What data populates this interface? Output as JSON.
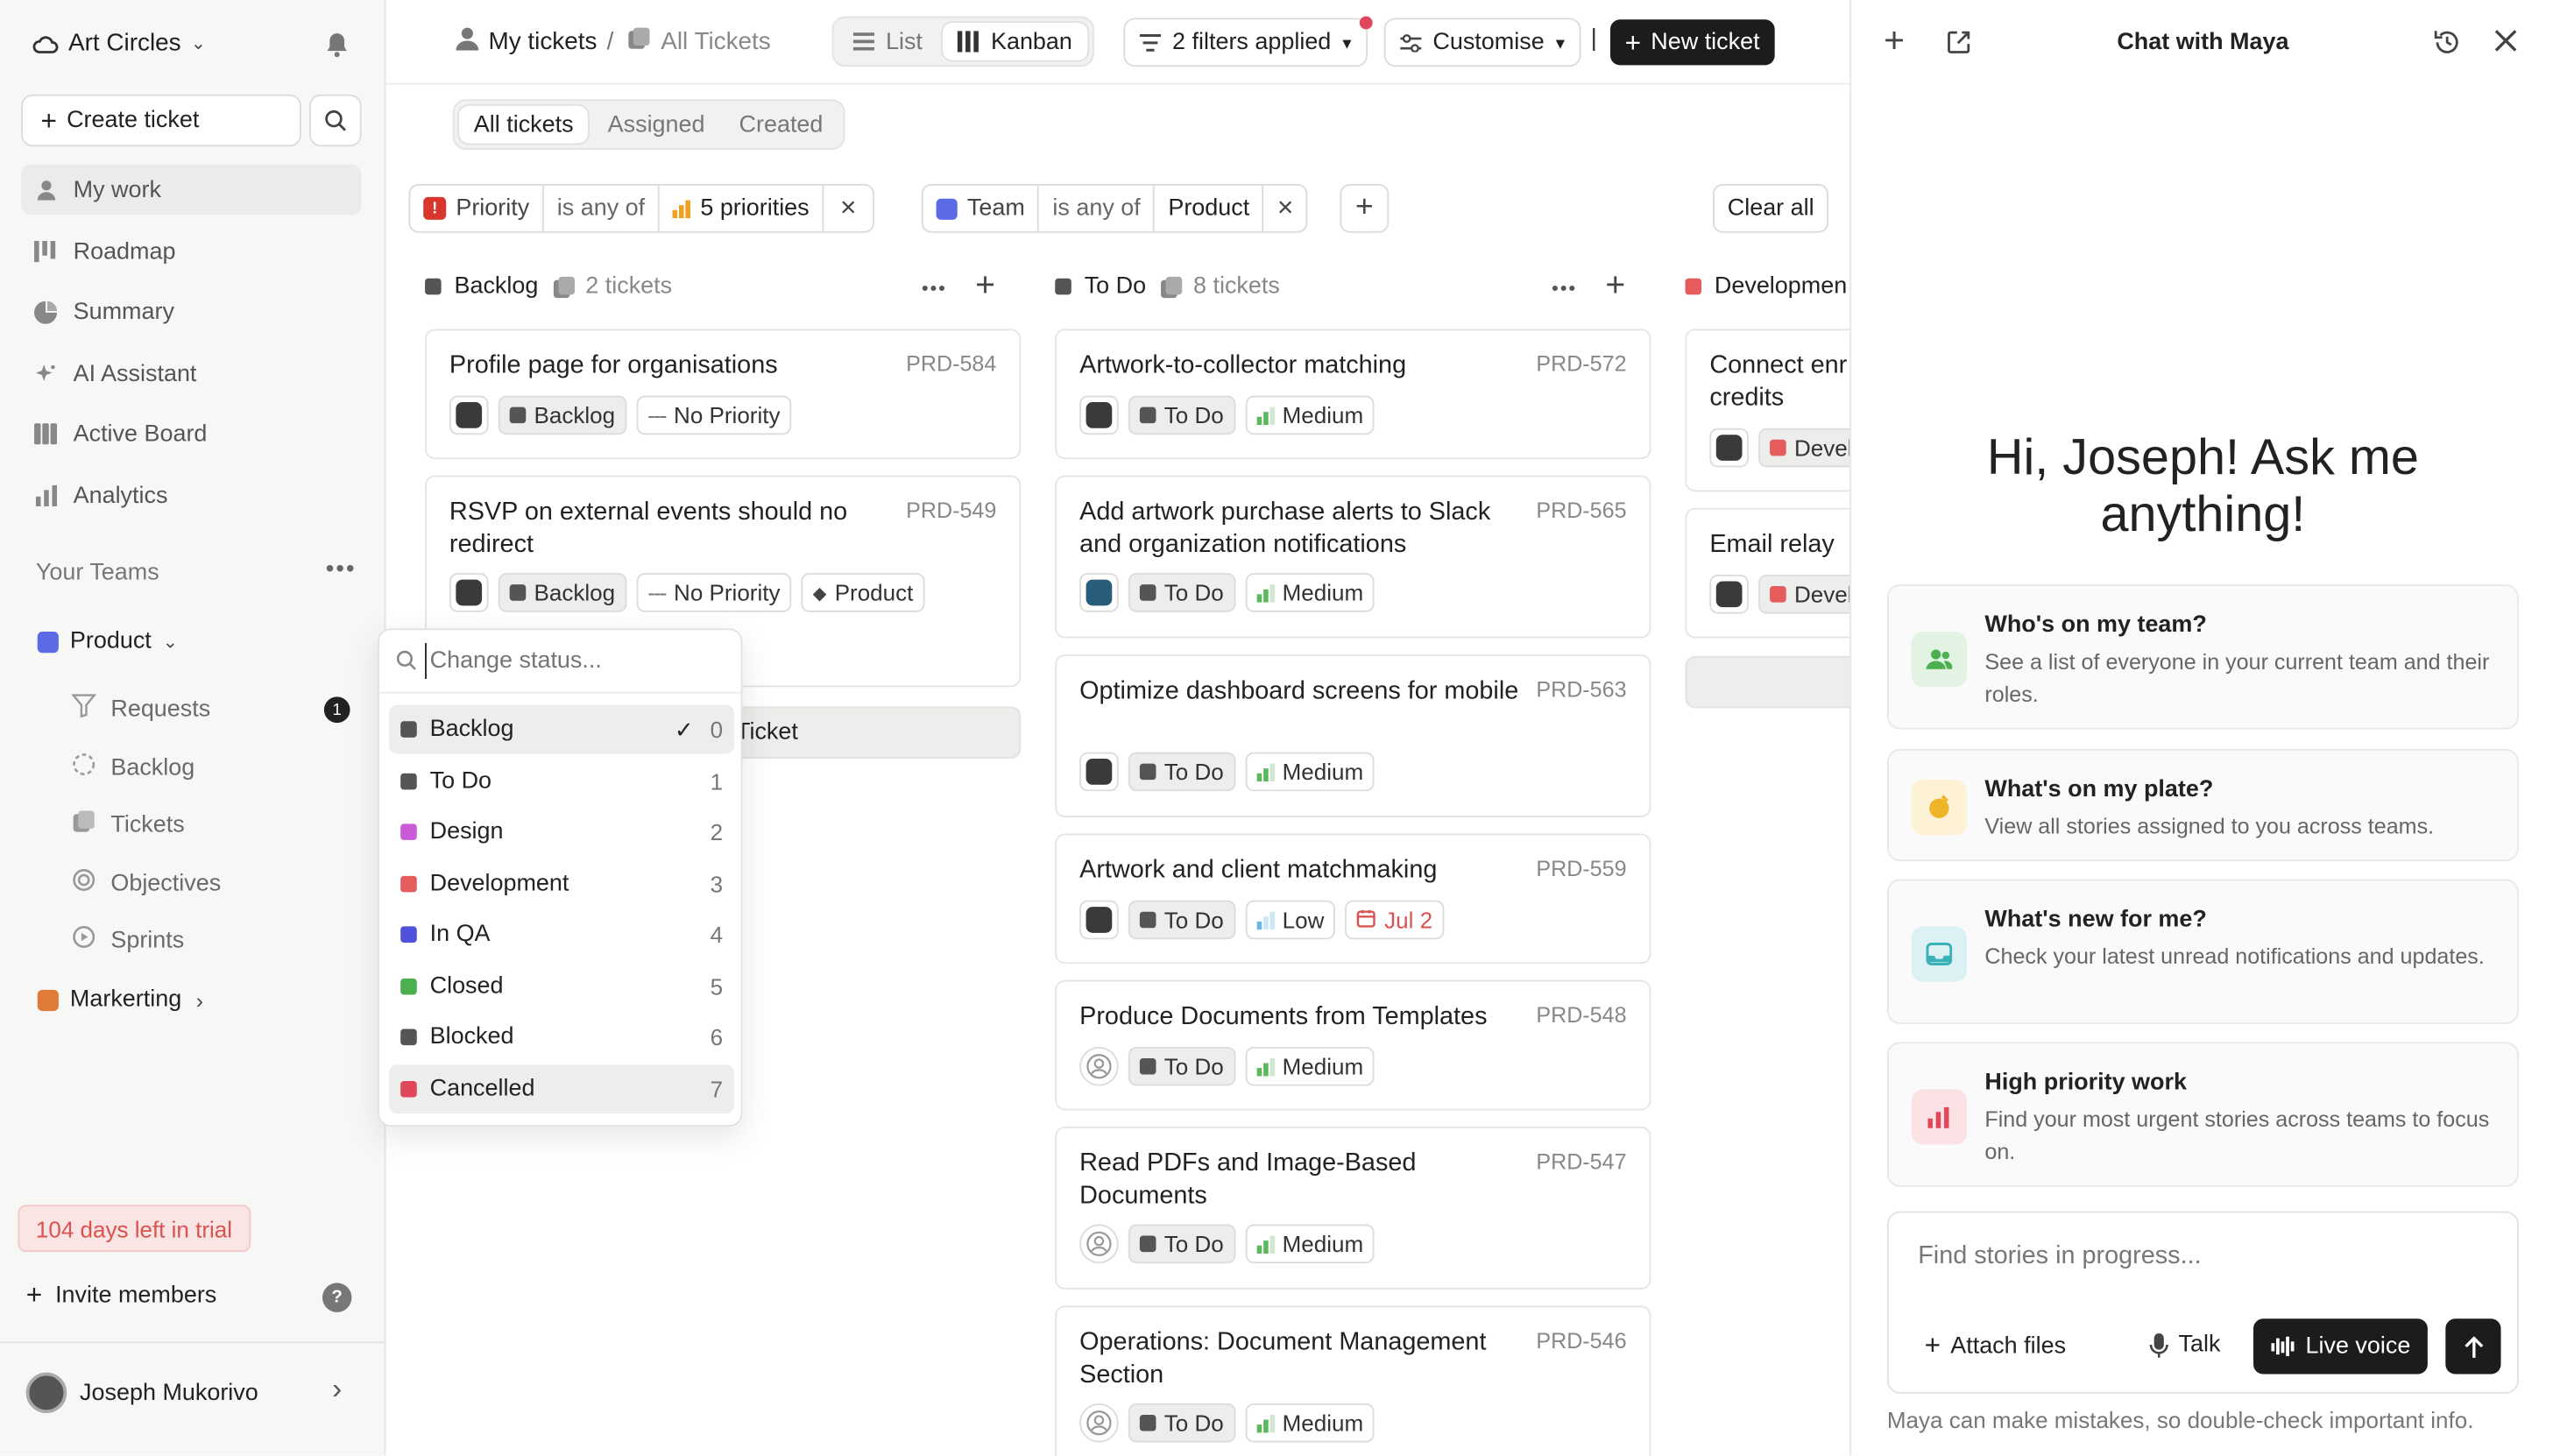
{
  "workspace": {
    "name": "Art Circles"
  },
  "sidebar": {
    "create_ticket": "Create ticket",
    "items": [
      {
        "label": "My work",
        "icon": "person-icon"
      },
      {
        "label": "Roadmap",
        "icon": "roadmap-icon"
      },
      {
        "label": "Summary",
        "icon": "summary-icon"
      },
      {
        "label": "AI Assistant",
        "icon": "sparkle-icon"
      },
      {
        "label": "Active Board",
        "icon": "board-icon"
      },
      {
        "label": "Analytics",
        "icon": "chart-icon"
      }
    ],
    "teams_heading": "Your Teams",
    "teams": [
      {
        "label": "Product",
        "color": "#5b6be6"
      },
      {
        "label": "Markerting",
        "color": "#e07b39"
      }
    ],
    "product_sub": [
      {
        "label": "Requests",
        "badge": "1"
      },
      {
        "label": "Backlog"
      },
      {
        "label": "Tickets"
      },
      {
        "label": "Objectives"
      },
      {
        "label": "Sprints"
      }
    ],
    "trial": "104 days left in trial",
    "invite": "Invite members",
    "help": "?",
    "user": "Joseph Mukorivo"
  },
  "topbar": {
    "crumb1": "My tickets",
    "crumb_sep": "/",
    "crumb2": "All Tickets",
    "view_list": "List",
    "view_kanban": "Kanban",
    "filters": "2 filters applied",
    "customise": "Customise",
    "sep": "|",
    "new_ticket": "New ticket"
  },
  "tabs": [
    "All tickets",
    "Assigned",
    "Created"
  ],
  "filters": {
    "f1_field": "Priority",
    "f1_op": "is any of",
    "f1_val": "5 priorities",
    "f2_field": "Team",
    "f2_op": "is any of",
    "f2_val": "Product",
    "clear": "Clear all",
    "remove": "×",
    "add": "+"
  },
  "columns": {
    "backlog": {
      "name": "Backlog",
      "count": "2 tickets",
      "color": "#555555"
    },
    "todo": {
      "name": "To Do",
      "count": "8 tickets",
      "color": "#555555"
    },
    "dev": {
      "name": "Developmen",
      "color": "#e45c5c"
    }
  },
  "backlog_cards": [
    {
      "title": "Profile page for organisations",
      "id": "PRD-584",
      "status": "Backlog",
      "priority": "No Priority"
    },
    {
      "title": "RSVP on external events should no redirect",
      "id": "PRD-549",
      "status": "Backlog",
      "priority": "No Priority",
      "team": "Product"
    }
  ],
  "backlog_new": "Ticket",
  "todo_cards": [
    {
      "title": "Artwork-to-collector matching",
      "id": "PRD-572",
      "status": "To Do",
      "priority": "Medium"
    },
    {
      "title": "Add artwork purchase alerts to Slack and organization notifications",
      "id": "PRD-565",
      "status": "To Do",
      "priority": "Medium"
    },
    {
      "title": "Optimize dashboard screens for mobile",
      "id": "PRD-563",
      "status": "To Do",
      "priority": "Medium"
    },
    {
      "title": "Artwork and client matchmaking",
      "id": "PRD-559",
      "status": "To Do",
      "priority": "Low",
      "date": "Jul 2"
    },
    {
      "title": "Produce Documents from Templates",
      "id": "PRD-548",
      "status": "To Do",
      "priority": "Medium"
    },
    {
      "title": "Read PDFs and Image-Based Documents",
      "id": "PRD-547",
      "status": "To Do",
      "priority": "Medium"
    },
    {
      "title": "Operations: Document Management Section",
      "id": "PRD-546",
      "status": "To Do",
      "priority": "Medium"
    }
  ],
  "dev_cards": [
    {
      "title": "Connect enr credits",
      "status": "Devel"
    },
    {
      "title": "Email relay",
      "status": "Devel"
    }
  ],
  "status_menu": {
    "placeholder": "Change status...",
    "checkmark": "✓",
    "items": [
      {
        "label": "Backlog",
        "num": "0",
        "color": "#555555"
      },
      {
        "label": "To Do",
        "num": "1",
        "color": "#555555"
      },
      {
        "label": "Design",
        "num": "2",
        "color": "#c95ad8"
      },
      {
        "label": "Development",
        "num": "3",
        "color": "#e45c5c"
      },
      {
        "label": "In QA",
        "num": "4",
        "color": "#4f52d9"
      },
      {
        "label": "Closed",
        "num": "5",
        "color": "#4caf50"
      },
      {
        "label": "Blocked",
        "num": "6",
        "color": "#555555"
      },
      {
        "label": "Cancelled",
        "num": "7",
        "color": "#e0475a"
      }
    ]
  },
  "chat": {
    "title": "Chat with Maya",
    "greeting": "Hi, Joseph! Ask me anything!",
    "suggestions": [
      {
        "title": "Who's on my team?",
        "desc": "See a list of everyone in your current team and their roles.",
        "icon": "team-icon",
        "color": "#4caf50"
      },
      {
        "title": "What's on my plate?",
        "desc": "View all stories assigned to you across teams.",
        "icon": "plate-icon",
        "color": "#f0b429"
      },
      {
        "title": "What's new for me?",
        "desc": "Check your latest unread notifications and updates.",
        "icon": "inbox-icon",
        "color": "#3ab0b8"
      },
      {
        "title": "High priority work",
        "desc": "Find your most urgent stories across teams to focus on.",
        "icon": "bar-chart-icon",
        "color": "#e0475a"
      }
    ],
    "input_placeholder": "Find stories in progress...",
    "attach": "Attach files",
    "talk": "Talk",
    "live_voice": "Live voice",
    "disclaimer": "Maya can make mistakes, so double-check important info."
  }
}
